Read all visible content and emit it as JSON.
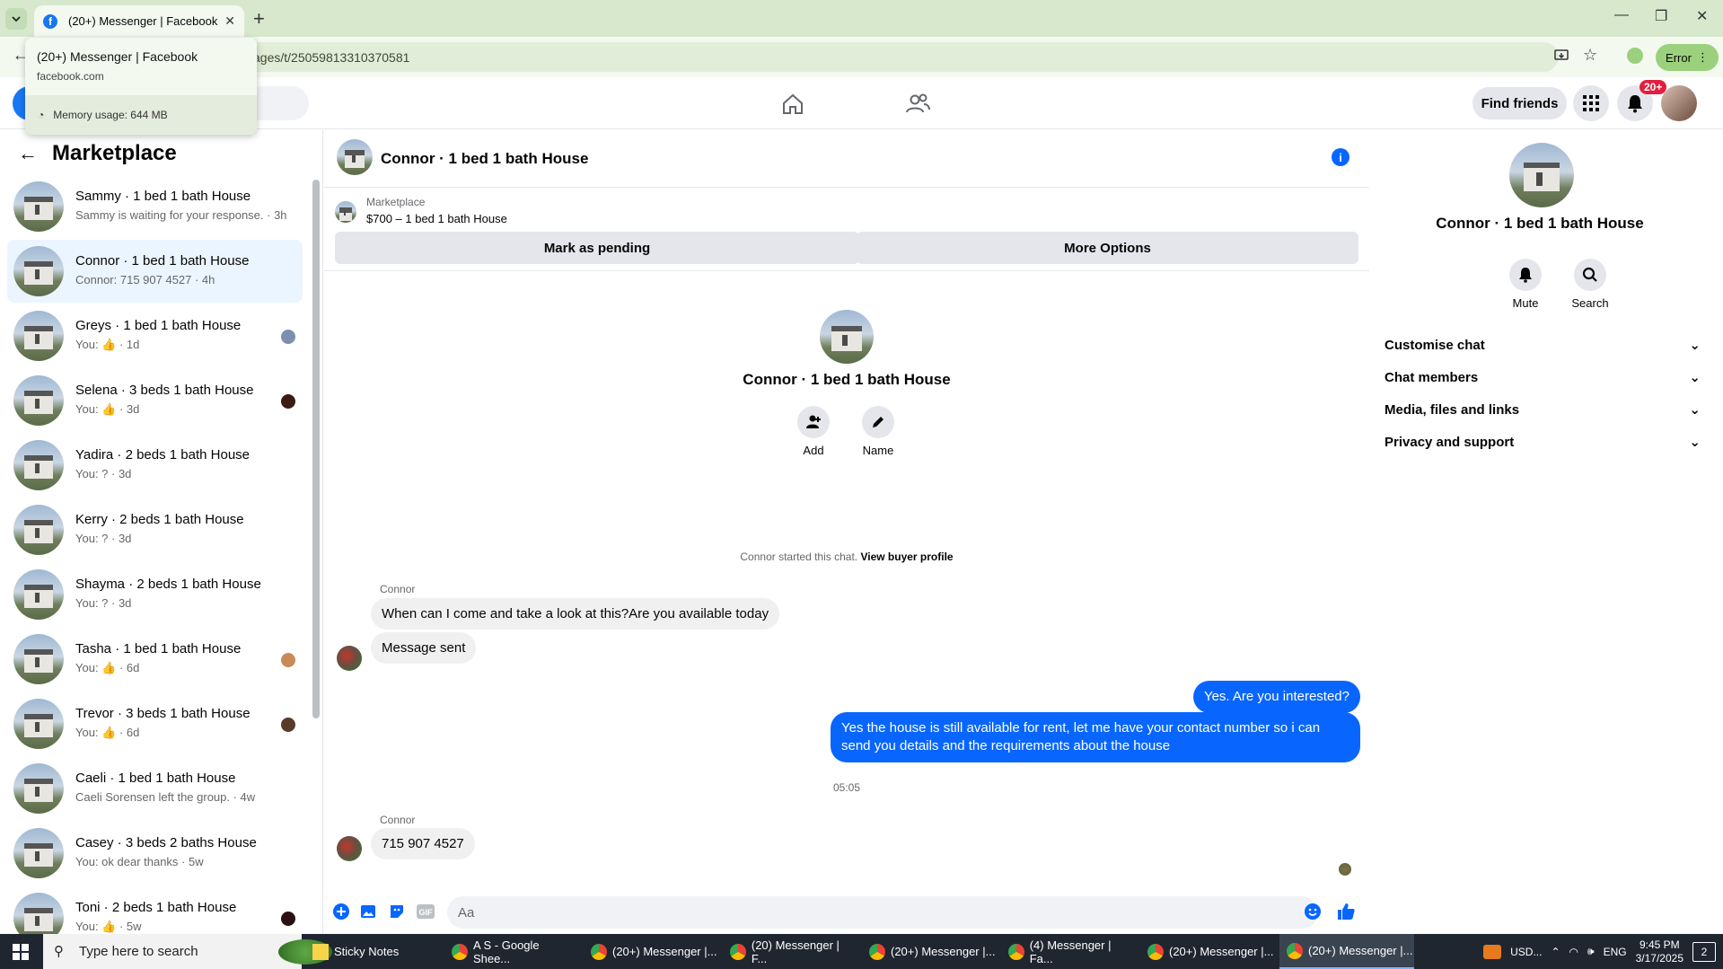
{
  "browser": {
    "tab_title": "(20+) Messenger | Facebook",
    "url": "ages/t/25059813310370581",
    "error_label": "Error",
    "tooltip": {
      "title": "(20+) Messenger | Facebook",
      "domain": "facebook.com",
      "memory": "Memory usage: 644 MB"
    }
  },
  "fbnav": {
    "find_friends": "Find friends",
    "notif_badge": "20+"
  },
  "sidebar": {
    "title": "Marketplace",
    "conversations": [
      {
        "name": "Sammy · 1 bed 1 bath House",
        "sub": "Sammy is waiting for your response. · 3h"
      },
      {
        "name": "Connor · 1 bed 1 bath House",
        "sub": "Connor: 715 907 4527 · 4h"
      },
      {
        "name": "Greys · 1 bed 1 bath House",
        "sub": "You: 👍 · 1d"
      },
      {
        "name": "Selena · 3 beds 1 bath House",
        "sub": "You: 👍 · 3d"
      },
      {
        "name": "Yadira · 2 beds 1 bath House",
        "sub": "You: ? · 3d"
      },
      {
        "name": "Kerry · 2 beds 1 bath House",
        "sub": "You: ? · 3d"
      },
      {
        "name": "Shayma · 2 beds 1 bath House",
        "sub": "You: ? · 3d"
      },
      {
        "name": "Tasha · 1 bed 1 bath House",
        "sub": "You: 👍 · 6d"
      },
      {
        "name": "Trevor · 3 beds 1 bath House",
        "sub": "You: 👍 · 6d"
      },
      {
        "name": "Caeli · 1 bed 1 bath House",
        "sub": "Caeli Sorensen left the group. · 4w"
      },
      {
        "name": "Casey · 3 beds 2 baths House",
        "sub": "You: ok dear thanks · 5w"
      },
      {
        "name": "Toni · 2 beds 1 bath House",
        "sub": "You: 👍 · 5w"
      }
    ]
  },
  "chat": {
    "header_name": "Connor · 1 bed 1 bath House",
    "listing_label": "Marketplace",
    "listing_price": "$700 – 1 bed 1 bath House",
    "mark_pending": "Mark as pending",
    "more_options": "More Options",
    "intro_name": "Connor · 1 bed 1 bath House",
    "add_label": "Add",
    "name_label": "Name",
    "started_text": "Connor started this chat.",
    "view_profile": "View buyer profile",
    "sender1": "Connor",
    "msg1": "When can I come and take a look at this?Are you available today",
    "msg2": "Message sent",
    "out1": "Yes. Are you interested?",
    "out2": "Yes the house is still available for rent, let me have your contact number so i can send you details and the requirements about the house",
    "time": "05:05",
    "sender2": "Connor",
    "msg3": "715 907 4527",
    "placeholder": "Aa"
  },
  "rpanel": {
    "name": "Connor · 1 bed 1 bath House",
    "mute": "Mute",
    "search": "Search",
    "sections": [
      "Customise chat",
      "Chat members",
      "Media, files and links",
      "Privacy and support"
    ]
  },
  "taskbar": {
    "search": "Type here to search",
    "items": [
      "Sticky Notes",
      "A S - Google Shee...",
      "(20+) Messenger |...",
      "(20) Messenger | F...",
      "(20+) Messenger |...",
      "(4) Messenger | Fa...",
      "(20+) Messenger |...",
      "(20+) Messenger |..."
    ],
    "currency": "USD...",
    "lang": "ENG",
    "time": "9:45 PM",
    "date": "3/17/2025",
    "notif_count": "2"
  }
}
